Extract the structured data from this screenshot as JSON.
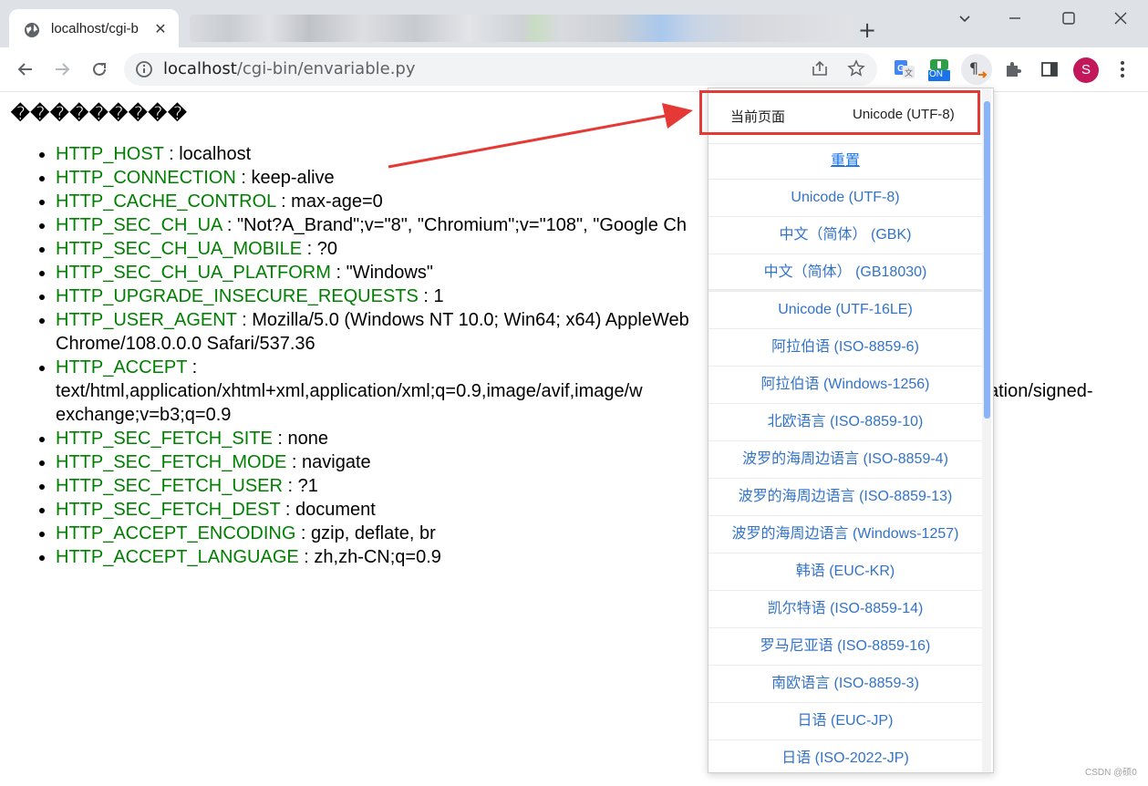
{
  "browser": {
    "tab_title": "localhost/cgi-b",
    "url_host": "localhost",
    "url_path": "/cgi-bin/envariable.py",
    "profile_initial": "S",
    "extension_badge": "ON"
  },
  "page": {
    "garbled_title": "���������",
    "env": [
      {
        "key": "HTTP_HOST",
        "value": " : localhost"
      },
      {
        "key": "HTTP_CONNECTION",
        "value": " : keep-alive"
      },
      {
        "key": "HTTP_CACHE_CONTROL",
        "value": " : max-age=0"
      },
      {
        "key": "HTTP_SEC_CH_UA",
        "value": " : \"Not?A_Brand\";v=\"8\", \"Chromium\";v=\"108\", \"Google Ch"
      },
      {
        "key": "HTTP_SEC_CH_UA_MOBILE",
        "value": " : ?0"
      },
      {
        "key": "HTTP_SEC_CH_UA_PLATFORM",
        "value": " : \"Windows\""
      },
      {
        "key": "HTTP_UPGRADE_INSECURE_REQUESTS",
        "value": " : 1"
      },
      {
        "key": "HTTP_USER_AGENT",
        "value": " : Mozilla/5.0 (Windows NT 10.0; Win64; x64) AppleWeb",
        "value2": "Chrome/108.0.0.0 Safari/537.36"
      },
      {
        "key": "HTTP_ACCEPT",
        "value": " :",
        "value2": "text/html,application/xhtml+xml,application/xml;q=0.9,image/avif,image/w",
        "value2b": "cation/signed-",
        "value3": "exchange;v=b3;q=0.9"
      },
      {
        "key": "HTTP_SEC_FETCH_SITE",
        "value": " : none"
      },
      {
        "key": "HTTP_SEC_FETCH_MODE",
        "value": " : navigate"
      },
      {
        "key": "HTTP_SEC_FETCH_USER",
        "value": " : ?1"
      },
      {
        "key": "HTTP_SEC_FETCH_DEST",
        "value": " : document"
      },
      {
        "key": "HTTP_ACCEPT_ENCODING",
        "value": " : gzip, deflate, br"
      },
      {
        "key": "HTTP_ACCEPT_LANGUAGE",
        "value": " : zh,zh-CN;q=0.9"
      }
    ]
  },
  "encoding_popup": {
    "current_label": "当前页面",
    "current_value": "Unicode (UTF-8)",
    "reset_label": "重置",
    "items": [
      "Unicode (UTF-8)",
      "中文（简体） (GBK)",
      "中文（简体） (GB18030)",
      "Unicode (UTF-16LE)",
      "阿拉伯语 (ISO-8859-6)",
      "阿拉伯语 (Windows-1256)",
      "北欧语言 (ISO-8859-10)",
      "波罗的海周边语言 (ISO-8859-4)",
      "波罗的海周边语言 (ISO-8859-13)",
      "波罗的海周边语言 (Windows-1257)",
      "韩语 (EUC-KR)",
      "凯尔特语 (ISO-8859-14)",
      "罗马尼亚语 (ISO-8859-16)",
      "南欧语言 (ISO-8859-3)",
      "日语 (EUC-JP)",
      "日语 (ISO-2022-JP)"
    ]
  },
  "watermark": "CSDN @硕0",
  "colors": {
    "env_key": "#008000",
    "popup_link": "#3273c9",
    "highlight": "#e53935"
  }
}
